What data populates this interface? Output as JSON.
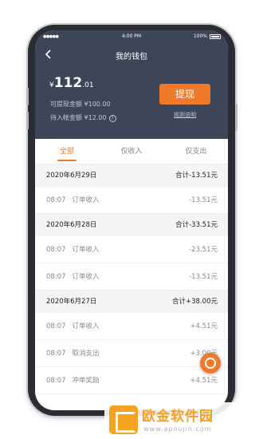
{
  "status_bar": {
    "signal": "●●●●●",
    "time": "4:00 PM",
    "battery": "100%"
  },
  "nav": {
    "title": "我的钱包"
  },
  "balance": {
    "currency": "¥",
    "integer": "112",
    "decimal": ".01"
  },
  "available": {
    "label": "可提现金额 ¥100.00"
  },
  "pending": {
    "label": "待入帐金额 ¥12.00",
    "help": "?"
  },
  "actions": {
    "withdraw": "提现",
    "rules": "规则说明"
  },
  "tabs": [
    {
      "label": "全部"
    },
    {
      "label": "仅收入"
    },
    {
      "label": "仅支出"
    }
  ],
  "groups": [
    {
      "date": "2020年6月29日",
      "total": "合计-13.51元",
      "items": [
        {
          "time": "08:07",
          "title": "订单收入",
          "amount": "-13.51元"
        }
      ]
    },
    {
      "date": "2020年6月28日",
      "total": "合计-33.51元",
      "items": [
        {
          "time": "08:07",
          "title": "订单收入",
          "amount": "-23.51元"
        },
        {
          "time": "08:07",
          "title": "订单收入",
          "amount": "-13.51元"
        }
      ]
    },
    {
      "date": "2020年6月27日",
      "total": "合计+38.00元",
      "items": [
        {
          "time": "08:07",
          "title": "订单收入",
          "amount": "+4.51元"
        },
        {
          "time": "08:07",
          "title": "取消支出",
          "amount": "+3.00元"
        },
        {
          "time": "08:07",
          "title": "冲单奖励",
          "amount": "+4.51元"
        }
      ]
    }
  ],
  "watermark": {
    "name": "欧金软件园",
    "url": "www.apoujin.com"
  }
}
